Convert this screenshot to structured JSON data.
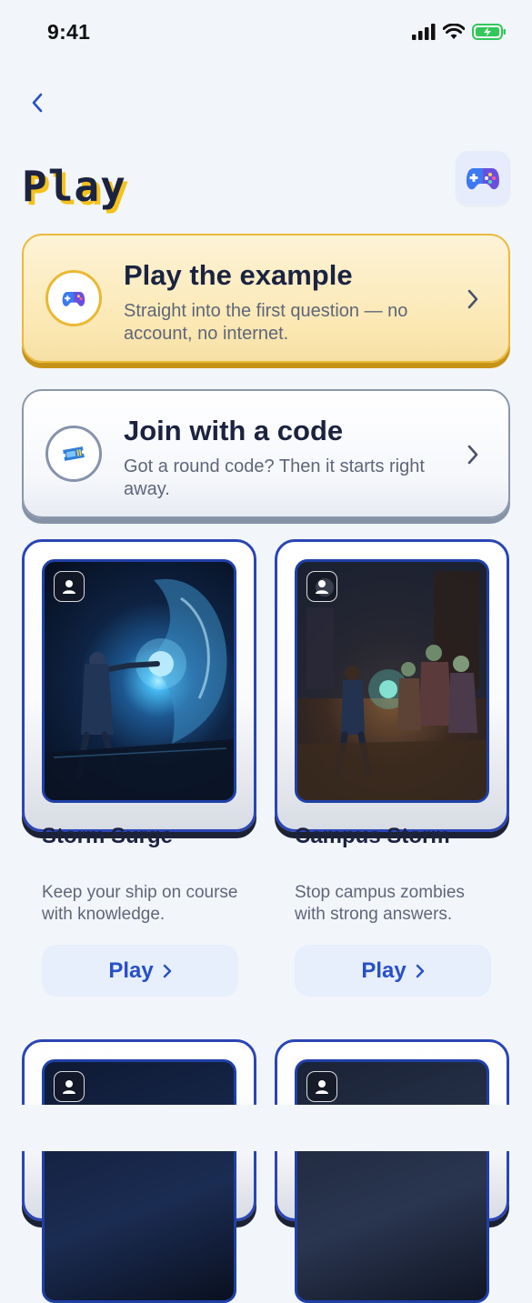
{
  "status_bar": {
    "time": "9:41"
  },
  "header": {
    "title": "Play"
  },
  "actions": [
    {
      "title": "Play the example",
      "subtitle": "Straight into the first question — no account, no internet."
    },
    {
      "title": "Join with a code",
      "subtitle": "Got a round code? Then it starts right away."
    }
  ],
  "games": [
    {
      "title": "Storm Surge",
      "description": "Keep your ship on course with knowledge.",
      "play_label": "Play"
    },
    {
      "title": "Campus Storm",
      "description": "Stop campus zombies with strong answers.",
      "play_label": "Play"
    }
  ],
  "colors": {
    "accent": "#2750c5",
    "gold": "#e9b93a",
    "card_border": "#2b45b5",
    "background": "#f2f6fb"
  }
}
